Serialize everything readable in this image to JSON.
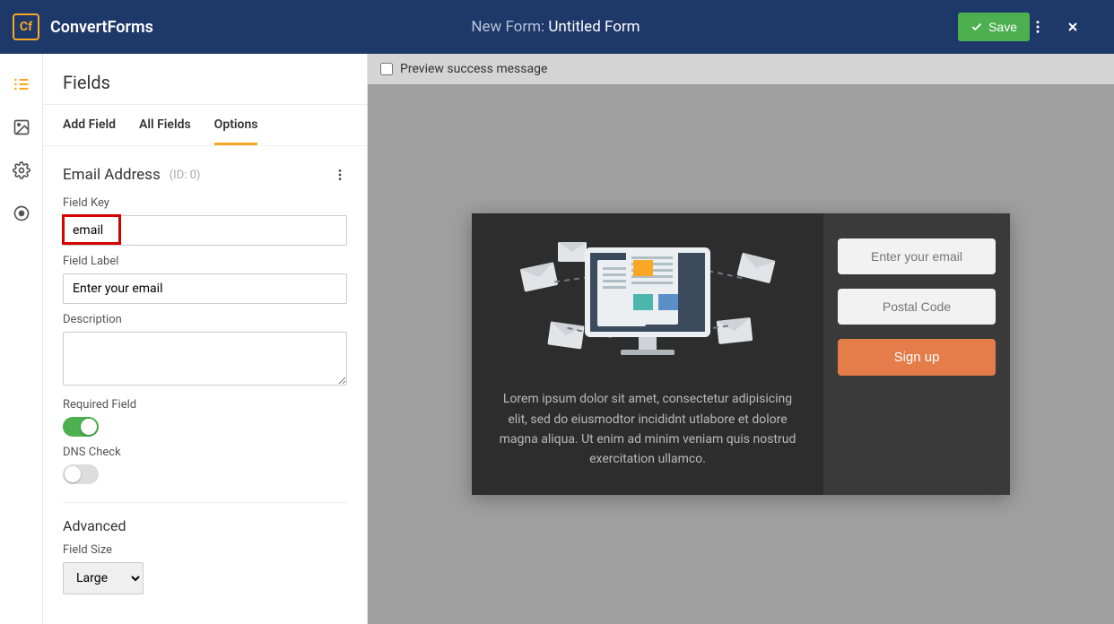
{
  "header": {
    "brand": "ConvertForms",
    "logo_text": "Cf",
    "title_prefix": "New Form:",
    "title_name": "Untitled Form",
    "save_label": "Save"
  },
  "rail": {
    "items": [
      "fields",
      "design",
      "settings",
      "publish"
    ]
  },
  "panel": {
    "title": "Fields",
    "tabs": {
      "add": "Add Field",
      "all": "All Fields",
      "options": "Options"
    },
    "field_title": "Email Address",
    "field_id": "(ID: 0)",
    "labels": {
      "field_key": "Field Key",
      "field_label": "Field Label",
      "description": "Description",
      "required": "Required Field",
      "dns": "DNS Check",
      "advanced": "Advanced",
      "field_size": "Field Size"
    },
    "values": {
      "field_key": "email",
      "field_label": "Enter your email",
      "description": "",
      "field_size": "Large"
    },
    "toggles": {
      "required": true,
      "dns": false
    }
  },
  "canvas": {
    "preview_label": "Preview success message",
    "lorem": "Lorem ipsum dolor sit amet, consectetur adipisicing elit, sed do eiusmodtor incididnt utlabore et dolore magna aliqua. Ut enim ad minim veniam quis nostrud exercitation ullamco.",
    "placeholders": {
      "email": "Enter your email",
      "postal": "Postal Code"
    },
    "signup_label": "Sign up"
  }
}
